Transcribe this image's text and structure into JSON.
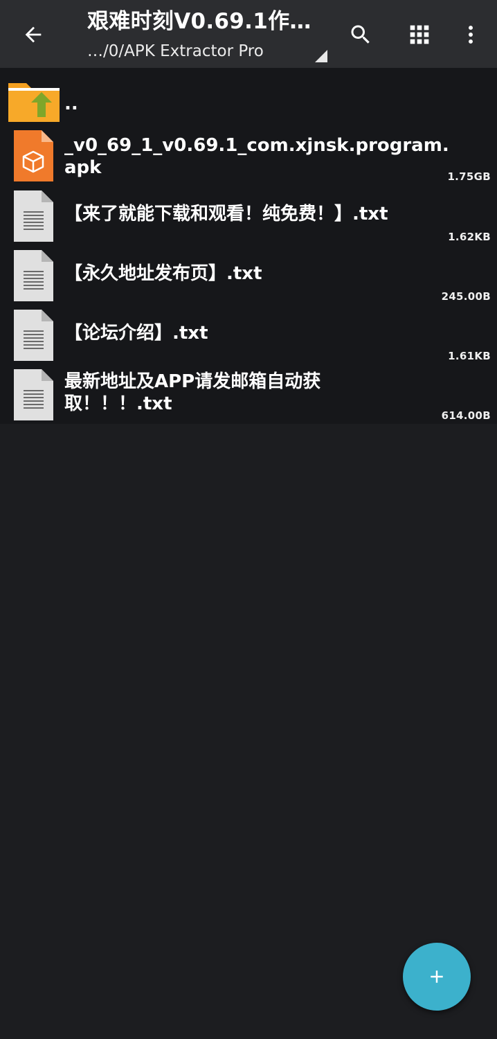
{
  "toolbar": {
    "title": "艰难时刻V0.69.1作…",
    "path": "…/0/APK Extractor Pro",
    "back_icon": "arrow-back-icon",
    "search_icon": "search-icon",
    "view_icon": "grid-view-icon",
    "menu_icon": "more-vert-icon"
  },
  "files": [
    {
      "name": "..",
      "size": "",
      "type": "parent-folder",
      "icon": "folder-up-icon"
    },
    {
      "name": "_v0_69_1_v0.69.1_com.xjnsk.program.apk",
      "size": "1.75GB",
      "type": "apk",
      "icon": "apk-file-icon"
    },
    {
      "name": "【来了就能下载和观看！纯免费！】.txt",
      "size": "1.62KB",
      "type": "txt",
      "icon": "text-file-icon"
    },
    {
      "name": "【永久地址发布页】.txt",
      "size": "245.00B",
      "type": "txt",
      "icon": "text-file-icon"
    },
    {
      "name": "【论坛介绍】.txt",
      "size": "1.61KB",
      "type": "txt",
      "icon": "text-file-icon"
    },
    {
      "name": "最新地址及APP请发邮箱自动获取！！！.txt",
      "size": "614.00B",
      "type": "txt",
      "icon": "text-file-icon"
    }
  ],
  "fab": {
    "icon": "add-icon"
  },
  "colors": {
    "toolbar_bg": "#2c2d30",
    "list_bg": "#16171a",
    "page_bg": "#1c1d20",
    "apk_orange": "#f07a2b",
    "folder_orange": "#f4a020",
    "folder_arrow_green": "#7fa62a",
    "fab_accent": "#3cb1cc"
  }
}
